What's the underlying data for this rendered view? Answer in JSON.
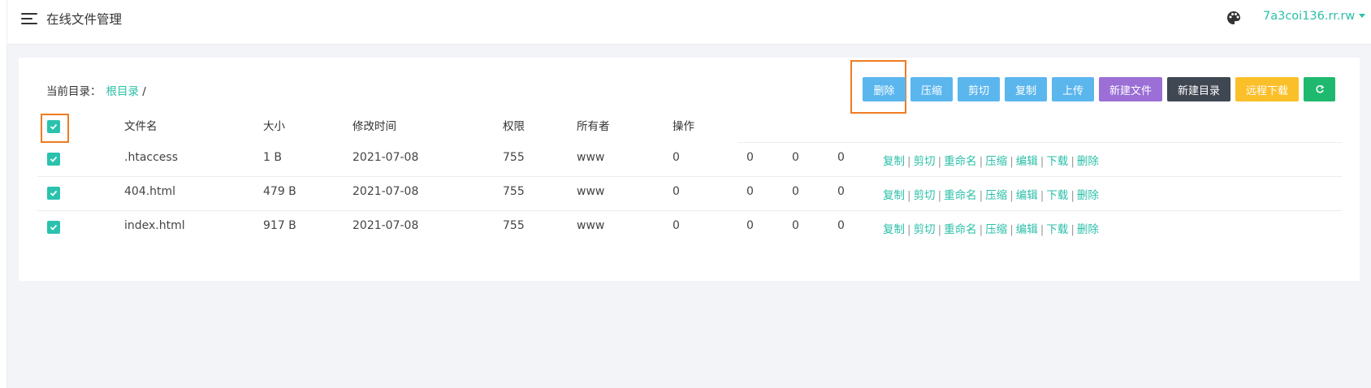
{
  "header": {
    "title": "在线文件管理",
    "user": "7a3coi136.rr.rw"
  },
  "breadcrumb": {
    "label": "当前目录：",
    "root": "根目录",
    "separator": "/"
  },
  "toolbar": {
    "delete": "删除",
    "compress": "压缩",
    "cut": "剪切",
    "copy": "复制",
    "upload": "上传",
    "new_file": "新建文件",
    "new_dir": "新建目录",
    "remote_download": "远程下载"
  },
  "table": {
    "columns": [
      "文件名",
      "大小",
      "修改时间",
      "权限",
      "所有者",
      "操作"
    ],
    "rows": [
      {
        "name": ".htaccess",
        "size": "1 B",
        "modified": "2021-07-08",
        "perm": "755",
        "owner": "www",
        "c1": "0",
        "c2": "0",
        "c3": "0",
        "c4": "0"
      },
      {
        "name": "404.html",
        "size": "479 B",
        "modified": "2021-07-08",
        "perm": "755",
        "owner": "www",
        "c1": "0",
        "c2": "0",
        "c3": "0",
        "c4": "0"
      },
      {
        "name": "index.html",
        "size": "917 B",
        "modified": "2021-07-08",
        "perm": "755",
        "owner": "www",
        "c1": "0",
        "c2": "0",
        "c3": "0",
        "c4": "0"
      }
    ],
    "row_actions": [
      "复制",
      "剪切",
      "重命名",
      "压缩",
      "编辑",
      "下载",
      "删除"
    ],
    "action_separator": "|"
  },
  "colors": {
    "accent": "#2bbfa8",
    "primary_button": "#5bb6ee",
    "highlight": "#f07c22"
  },
  "icons": [
    "menu-icon",
    "palette-icon",
    "caret-down-icon",
    "check-icon",
    "refresh-icon"
  ]
}
